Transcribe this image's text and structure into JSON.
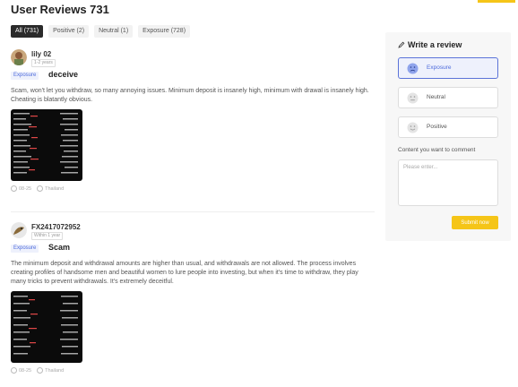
{
  "header": {
    "title": "User Reviews 731"
  },
  "tabs": [
    {
      "label": "All (731)"
    },
    {
      "label": "Positive (2)"
    },
    {
      "label": "Neutral (1)"
    },
    {
      "label": "Exposure (728)"
    }
  ],
  "reviews": [
    {
      "username": "lily 02",
      "badge": "1-2 years",
      "type": "Exposure",
      "title": "deceive",
      "content": "Scam, won't let you withdraw, so many annoying issues. Minimum deposit is insanely high, minimum with drawal is insanely high. Cheating is blatantly obvious.",
      "date": "08-25",
      "country": "Thailand"
    },
    {
      "username": "FX2417072952",
      "badge": "Within 1 year",
      "type": "Exposure",
      "title": "Scam",
      "content": "The minimum deposit and withdrawal amounts are higher than usual, and withdrawals are not allowed. The process involves creating profiles of handsome men and beautiful women to lure people into investing, but when it's time to withdraw, they play many tricks to prevent withdrawals. It's extremely deceitful.",
      "date": "08-25",
      "country": "Thailand"
    }
  ],
  "panel": {
    "title": "Write a review",
    "options": [
      {
        "label": "Exposure",
        "selected": true
      },
      {
        "label": "Neutral",
        "selected": false
      },
      {
        "label": "Positive",
        "selected": false
      }
    ],
    "content_label": "Content you want to comment",
    "placeholder": "Please enter...",
    "submit_label": "Submit now"
  },
  "colors": {
    "accent": "#f5c518",
    "exposure": "#4d6bdc",
    "active_tab": "#2a2a2a"
  }
}
